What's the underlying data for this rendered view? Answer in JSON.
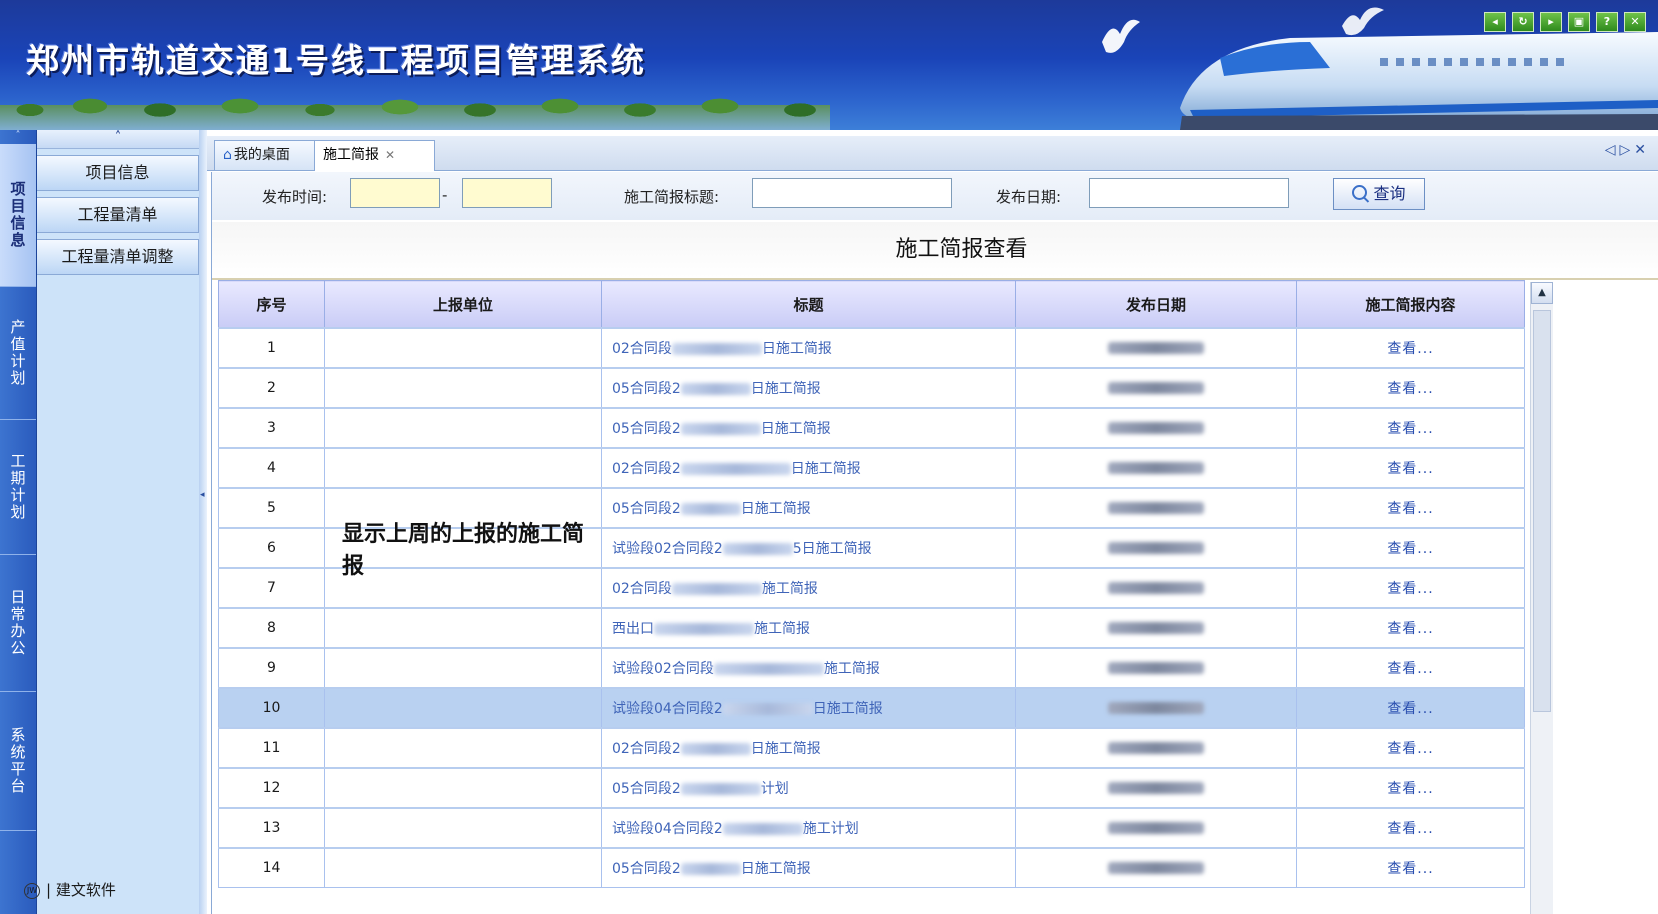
{
  "app": {
    "title": "郑州市轨道交通1号线工程项目管理系统",
    "footer_brand": "建文软件",
    "footer_logo": "JW"
  },
  "window_controls": [
    "arrow-left-icon",
    "refresh-icon",
    "arrow-right-icon",
    "help-icon",
    "question-icon",
    "close-icon"
  ],
  "vertical_tabs": [
    {
      "label": "项目信息",
      "active": true
    },
    {
      "label": "产值计划",
      "active": false
    },
    {
      "label": "工期计划",
      "active": false
    },
    {
      "label": "日常办公",
      "active": false
    },
    {
      "label": "系统平台",
      "active": false
    }
  ],
  "menu": {
    "items": [
      "项目信息",
      "工程量清单",
      "工程量清单调整"
    ]
  },
  "tabs": [
    {
      "label": "我的桌面",
      "closable": false
    },
    {
      "label": "施工简报",
      "closable": true
    }
  ],
  "filter": {
    "publish_time_label": "发布时间:",
    "range_sep": "-",
    "report_title_label": "施工简报标题:",
    "publish_date_label": "发布日期:",
    "query_button": "查询"
  },
  "page_title": "施工简报查看",
  "grid": {
    "columns": [
      "序号",
      "上报单位",
      "标题",
      "发布日期",
      "施工简报内容"
    ],
    "view_text": "查看...",
    "selected_row": 10,
    "rows": [
      {
        "no": "1",
        "prefix": "02合同段",
        "suffix": "日施工简报"
      },
      {
        "no": "2",
        "prefix": "05合同段2",
        "suffix": "日施工简报"
      },
      {
        "no": "3",
        "prefix": "05合同段2",
        "suffix": "日施工简报"
      },
      {
        "no": "4",
        "prefix": "02合同段2",
        "suffix": "日施工简报"
      },
      {
        "no": "5",
        "prefix": "05合同段2",
        "suffix": "日施工简报"
      },
      {
        "no": "6",
        "prefix": "试验段02合同段2",
        "suffix": "5日施工简报"
      },
      {
        "no": "7",
        "prefix": "02合同段",
        "suffix": "施工简报"
      },
      {
        "no": "8",
        "prefix": "西出口",
        "suffix": "施工简报"
      },
      {
        "no": "9",
        "prefix": "试验段02合同段",
        "suffix": "施工简报"
      },
      {
        "no": "10",
        "prefix": "试验段04合同段2",
        "suffix": "日施工简报"
      },
      {
        "no": "11",
        "prefix": "02合同段2",
        "suffix": "日施工简报"
      },
      {
        "no": "12",
        "prefix": "05合同段2",
        "suffix": "计划"
      },
      {
        "no": "13",
        "prefix": "试验段04合同段2",
        "suffix": "施工计划"
      },
      {
        "no": "14",
        "prefix": "05合同段2",
        "suffix": "日施工简报"
      }
    ]
  },
  "annotation": "显示上周的上报的施工简报",
  "colors": {
    "header": "#1d3a9a",
    "menu_bg": "#cde3f9",
    "selected_row": "#b9d1f1",
    "link": "#3f64b8"
  }
}
